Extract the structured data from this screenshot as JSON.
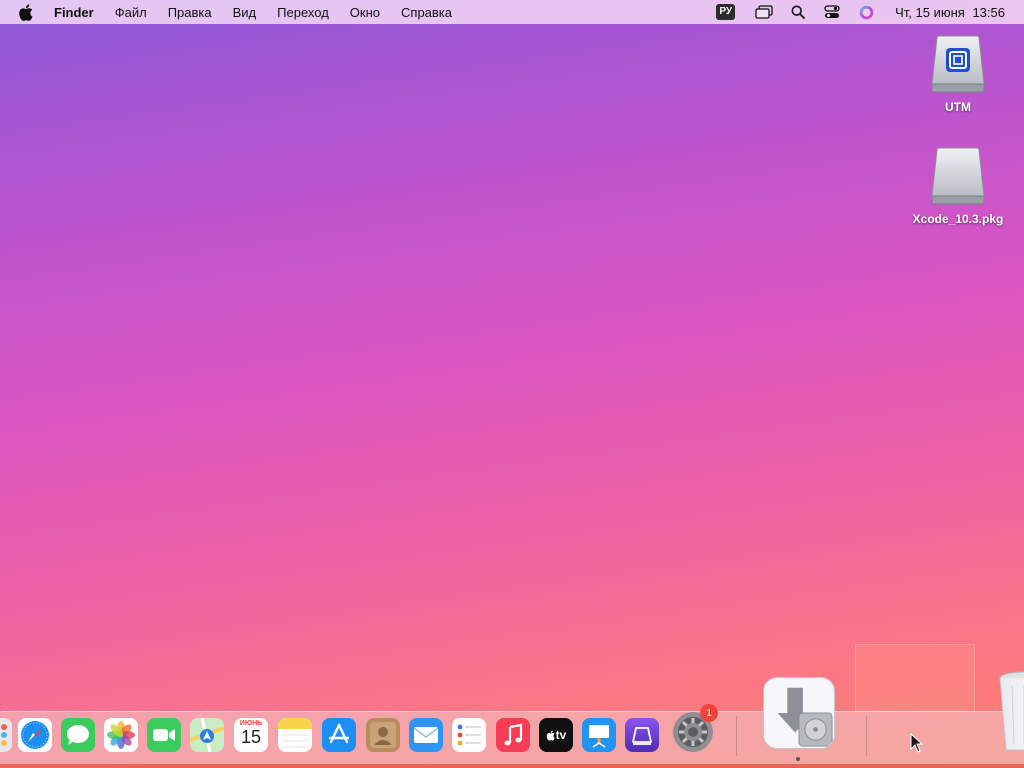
{
  "menubar": {
    "app_name": "Finder",
    "menus": [
      "Файл",
      "Правка",
      "Вид",
      "Переход",
      "Окно",
      "Справка"
    ],
    "input_source": "РУ",
    "date": "Чт, 15 июня",
    "time": "13:56"
  },
  "desktop": {
    "icons": [
      {
        "label": "UTM",
        "icon": "disk-image-icon"
      },
      {
        "label": "Xcode_10.3.pkg",
        "icon": "disk-image-icon"
      }
    ]
  },
  "dock": {
    "apps": [
      {
        "name": "Launchpad",
        "icon": "launchpad-icon"
      },
      {
        "name": "Safari",
        "icon": "safari-icon"
      },
      {
        "name": "Messages",
        "icon": "messages-icon"
      },
      {
        "name": "Photos",
        "icon": "photos-icon"
      },
      {
        "name": "FaceTime",
        "icon": "facetime-icon"
      },
      {
        "name": "Maps",
        "icon": "maps-icon"
      },
      {
        "name": "Calendar",
        "icon": "calendar-icon"
      },
      {
        "name": "Notes",
        "icon": "notes-icon"
      },
      {
        "name": "App Store",
        "icon": "app-store-icon"
      },
      {
        "name": "Contacts",
        "icon": "contacts-icon"
      },
      {
        "name": "Mail",
        "icon": "mail-icon"
      },
      {
        "name": "Reminders",
        "icon": "reminders-icon"
      },
      {
        "name": "Music",
        "icon": "music-icon"
      },
      {
        "name": "TV",
        "icon": "tv-icon"
      },
      {
        "name": "Keynote",
        "icon": "keynote-icon"
      },
      {
        "name": "Podcasts",
        "icon": "podcasts-icon"
      },
      {
        "name": "System Settings",
        "icon": "settings-icon"
      }
    ],
    "calendar_month": "ИЮНЬ",
    "calendar_day": "15",
    "tv_label": "tv",
    "settings_badge": "1",
    "installer": {
      "name": "Installer",
      "icon": "installer-icon"
    },
    "trash": {
      "name": "Trash",
      "icon": "trash-icon"
    }
  },
  "colors": {
    "wallpaper_top": "#8a58d8",
    "wallpaper_mid": "#d955c4",
    "wallpaper_bottom": "#f97e6e",
    "badge": "#f0433a"
  }
}
